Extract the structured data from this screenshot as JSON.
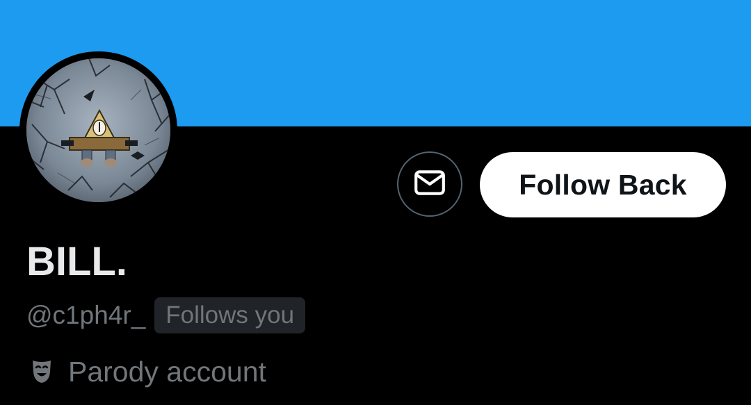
{
  "profile": {
    "display_name": "BILL.",
    "handle": "@c1ph4r_",
    "follows_badge": "Follows you",
    "label_icon": "theater-mask-icon",
    "label_text": "Parody account"
  },
  "actions": {
    "message_icon": "envelope-icon",
    "follow_label": "Follow Back"
  },
  "colors": {
    "banner": "#1d9bf0",
    "background": "#000000",
    "primary_text": "#e7e9ea",
    "secondary_text": "#71767b",
    "button_bg": "#ffffff",
    "button_text": "#0f1419",
    "badge_bg": "#202327",
    "border": "#536471"
  }
}
